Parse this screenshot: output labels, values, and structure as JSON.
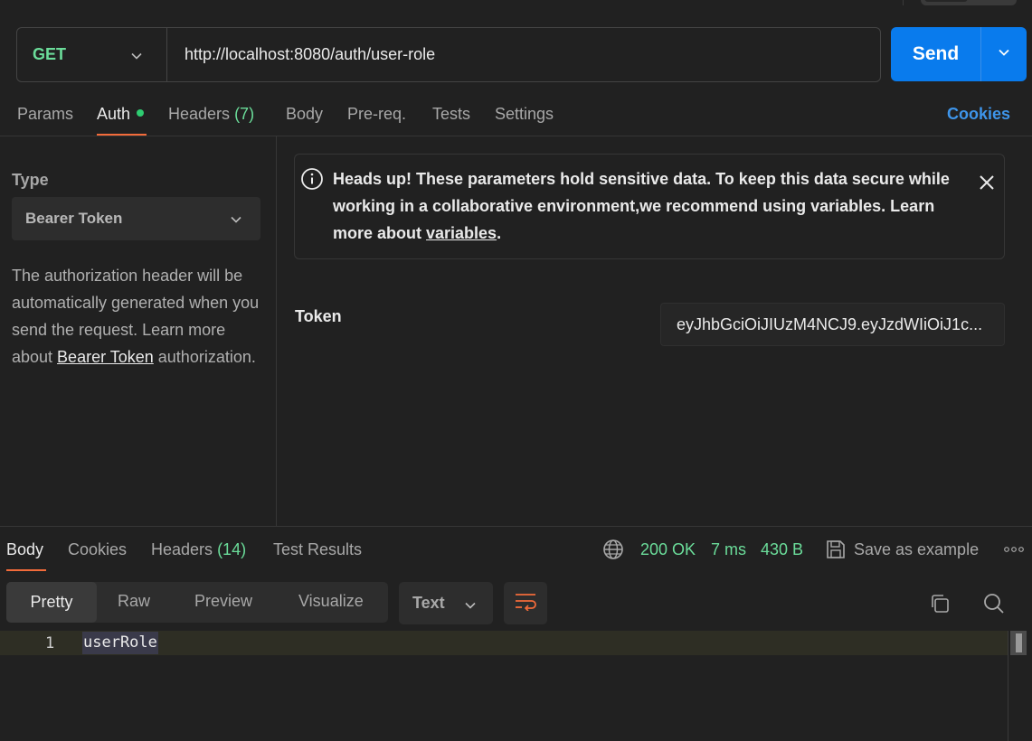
{
  "request": {
    "method": "GET",
    "url": "http://localhost:8080/auth/user-role",
    "send_label": "Send"
  },
  "request_tabs": {
    "params": "Params",
    "auth": "Auth",
    "headers": "Headers",
    "headers_count": "(7)",
    "body": "Body",
    "prereq": "Pre-req.",
    "tests": "Tests",
    "settings": "Settings",
    "cookies": "Cookies"
  },
  "auth": {
    "type_label": "Type",
    "type_value": "Bearer Token",
    "desc_before": "The authorization header will be automatically generated when you send the request. Learn more about ",
    "desc_link": "Bearer Token",
    "desc_after": " authorization.",
    "alert_text": "Heads up! These parameters hold sensitive data. To keep this data secure while working in a collaborative environment,we recommend using variables. Learn more about ",
    "alert_link": "variables",
    "alert_end": ".",
    "token_label": "Token",
    "token_value": "eyJhbGciOiJIUzM4NCJ9.eyJzdWIiOiJ1c..."
  },
  "response_tabs": {
    "body": "Body",
    "cookies": "Cookies",
    "headers": "Headers",
    "headers_count": "(14)",
    "test_results": "Test Results"
  },
  "response_status": {
    "status": "200 OK",
    "time": "7 ms",
    "size": "430 B",
    "save_example": "Save as example"
  },
  "view_tabs": {
    "pretty": "Pretty",
    "raw": "Raw",
    "preview": "Preview",
    "visualize": "Visualize"
  },
  "format": "Text",
  "editor": {
    "line_number": "1",
    "content": "userRole"
  },
  "colors": {
    "accent": "#097bed",
    "method_green": "#6bdd9a",
    "tab_underline": "#f26b3a",
    "link_blue": "#3e95ea"
  }
}
